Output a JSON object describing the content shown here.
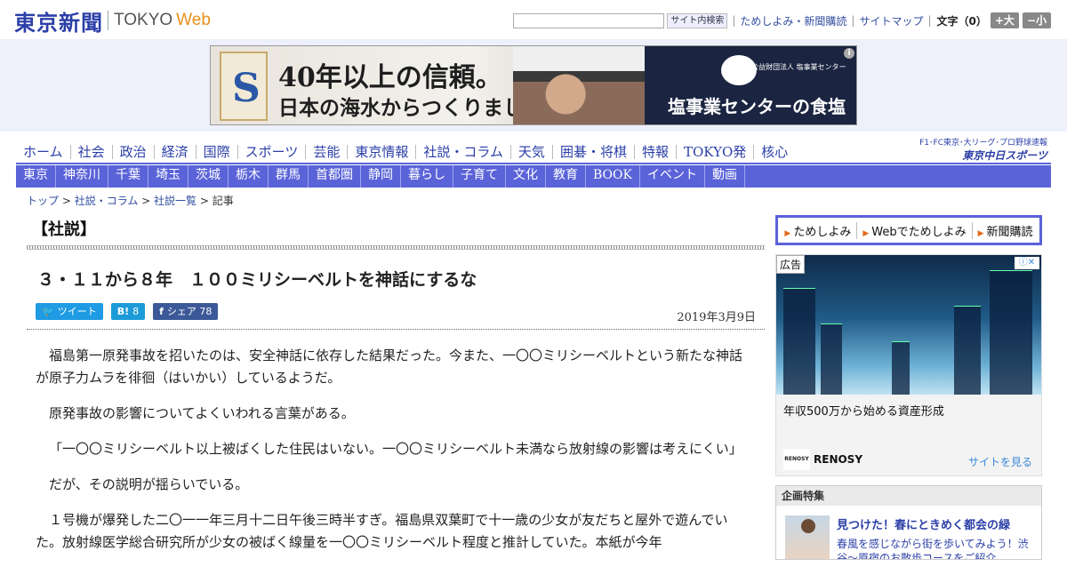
{
  "header": {
    "logo_jp": "東京新聞",
    "logo_en": "TOKYO",
    "logo_web": "Web",
    "search_button": "サイト内検索",
    "links": [
      "ためしよみ・新聞購読",
      "サイトマップ"
    ],
    "font_size_label": "文字（0）",
    "font_bigger": "+大",
    "font_smaller": "−小"
  },
  "banner": {
    "line1": "40年以上の信頼。",
    "line2": "日本の海水からつくりました。",
    "org_small": "公益財団法人 塩事業センター",
    "right_text": "塩事業センターの食塩",
    "info_icon": "i"
  },
  "nav": {
    "main": [
      "ホーム",
      "社会",
      "政治",
      "経済",
      "国際",
      "スポーツ",
      "芸能",
      "東京情報",
      "社説・コラム",
      "天気",
      "囲碁・将棋",
      "特報",
      "TOKYO発",
      "核心"
    ],
    "sub": [
      "東京",
      "神奈川",
      "千葉",
      "埼玉",
      "茨城",
      "栃木",
      "群馬",
      "首都圏",
      "静岡",
      "暮らし",
      "子育て",
      "文化",
      "教育",
      "BOOK",
      "イベント",
      "動画"
    ],
    "chunichi_top": "F1･FC東京･大リーグ･プロ野球速報",
    "chunichi_main": "東京中日スポーツ"
  },
  "breadcrumb": {
    "items": [
      "トップ",
      "社説・コラム",
      "社説一覧"
    ],
    "current": "記事",
    "sep": " > "
  },
  "article": {
    "section": "【社説】",
    "headline": "３・１１から８年　１００ミリシーベルトを神話にするな",
    "social": {
      "tweet": "ツイート",
      "hatena_icon": "B!",
      "hatena_count": "8",
      "fb_icon": "f",
      "fb_label": "シェア",
      "fb_count": "78"
    },
    "date": "2019年3月9日",
    "paragraphs": [
      "福島第一原発事故を招いたのは、安全神話に依存した結果だった。今また、一〇〇ミリシーベルトという新たな神話が原子力ムラを徘徊（はいかい）しているようだ。",
      "原発事故の影響についてよくいわれる言葉がある。",
      "「一〇〇ミリシーベルト以上被ばくした住民はいない。一〇〇ミリシーベルト未満なら放射線の影響は考えにくい」",
      "だが、その説明が揺らいでいる。",
      "１号機が爆発した二〇一一年三月十二日午後三時半すぎ。福島県双葉町で十一歳の少女が友だちと屋外で遊んでいた。放射線医学総合研究所が少女の被ばく線量を一〇〇ミリシーベルト程度と推計していた。本紙が今年"
    ]
  },
  "sidebar": {
    "promo": [
      "ためしよみ",
      "Webでためしよみ",
      "新聞購読"
    ],
    "ad": {
      "tag": "広告",
      "text": "年収500万から始める資産形成",
      "brand_logo": "RENOSY",
      "brand": "RENOSY",
      "cta": "サイトを見る"
    },
    "feature": {
      "head": "企画特集",
      "title": "見つけた！春にときめく都会の緑",
      "desc": "春風を感じながら街を歩いてみよう！渋谷～原宿のお散歩コースをご紹介"
    }
  }
}
